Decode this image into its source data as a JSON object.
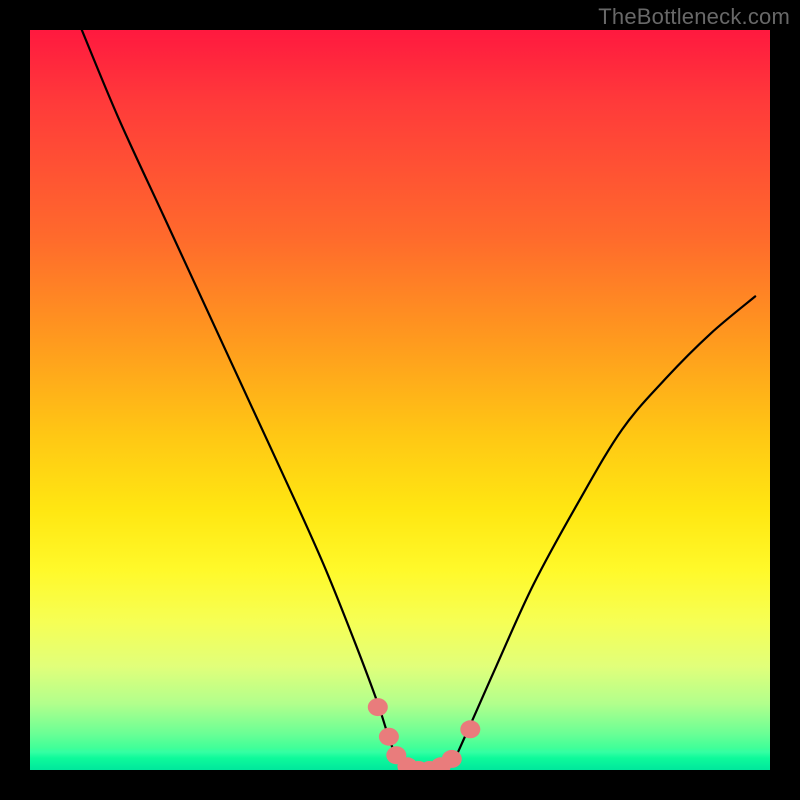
{
  "watermark": "TheBottleneck.com",
  "colors": {
    "frame": "#000000",
    "curve": "#000000",
    "marker_fill": "#e97c7c",
    "marker_stroke": "#e97c7c"
  },
  "chart_data": {
    "type": "line",
    "title": "",
    "xlabel": "",
    "ylabel": "",
    "xlim": [
      0,
      100
    ],
    "ylim": [
      0,
      100
    ],
    "grid": false,
    "legend": false,
    "annotations": [
      "TheBottleneck.com"
    ],
    "series": [
      {
        "name": "bottleneck-curve",
        "x": [
          7,
          12,
          18,
          24,
          30,
          36,
          40,
          44,
          47,
          49,
          51,
          53,
          55,
          57,
          59,
          63,
          68,
          74,
          80,
          86,
          92,
          98
        ],
        "y": [
          100,
          88,
          75,
          62,
          49,
          36,
          27,
          17,
          9,
          3,
          0,
          0,
          0,
          1,
          5,
          14,
          25,
          36,
          46,
          53,
          59,
          64
        ]
      }
    ],
    "markers": [
      {
        "x": 47.0,
        "y": 8.5
      },
      {
        "x": 48.5,
        "y": 4.5
      },
      {
        "x": 49.5,
        "y": 2.0
      },
      {
        "x": 51.0,
        "y": 0.5
      },
      {
        "x": 52.5,
        "y": 0.0
      },
      {
        "x": 54.0,
        "y": 0.0
      },
      {
        "x": 55.5,
        "y": 0.5
      },
      {
        "x": 57.0,
        "y": 1.5
      },
      {
        "x": 59.5,
        "y": 5.5
      }
    ]
  }
}
